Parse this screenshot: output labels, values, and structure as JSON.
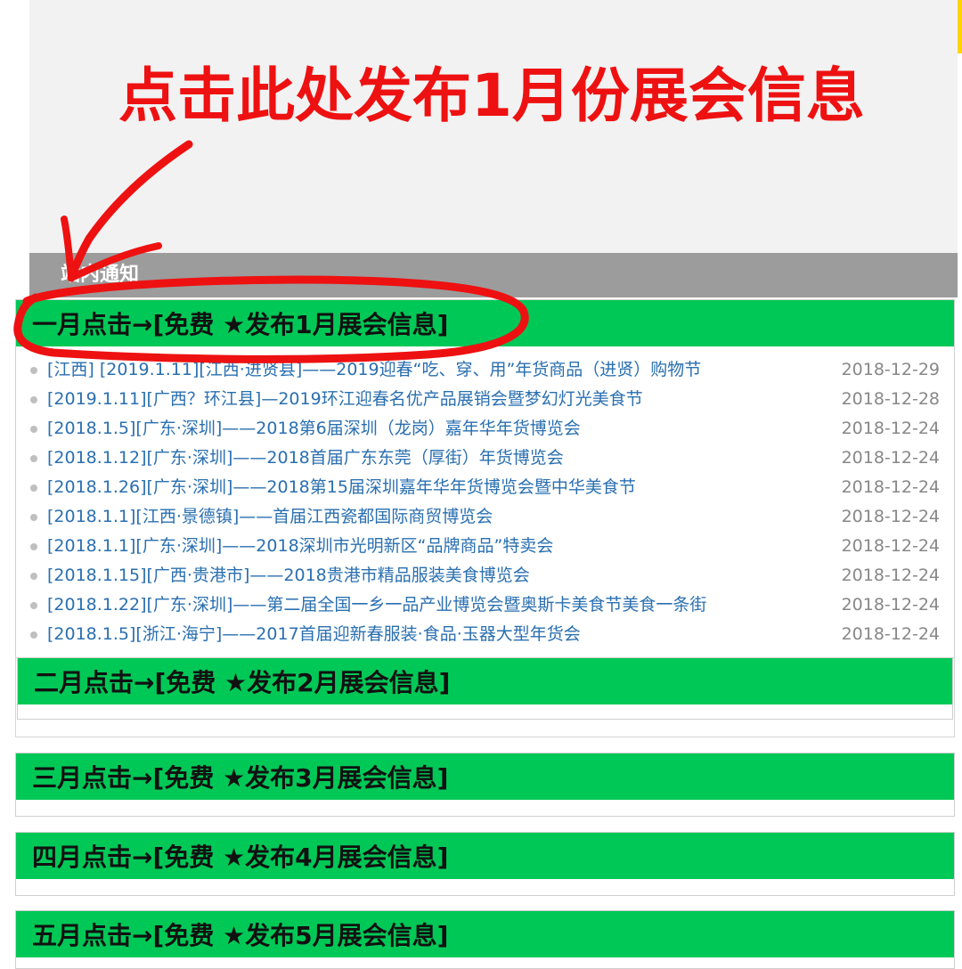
{
  "annotation": {
    "title": "点击此处发布1月份展会信息",
    "color": "#ee1111"
  },
  "notice": {
    "title": "站内通知"
  },
  "colors": {
    "header_green": "#00c857",
    "link_blue": "#2a6fb0",
    "date_gray": "#888888"
  },
  "months": [
    {
      "header": "一月点击→[免费 ★发布1月展会信息]",
      "items": [
        {
          "text": "[江西] [2019.1.11][江西·进贤县]——2019迎春“吃、穿、用”年货商品（进贤）购物节",
          "date": "2018-12-29"
        },
        {
          "text": "[2019.1.11][广西？环江县]—2019环江迎春名优产品展销会暨梦幻灯光美食节",
          "date": "2018-12-28"
        },
        {
          "text": "[2018.1.5][广东·深圳]——2018第6届深圳（龙岗）嘉年华年货博览会",
          "date": "2018-12-24"
        },
        {
          "text": "[2018.1.12][广东·深圳]——2018首届广东东莞（厚街）年货博览会",
          "date": "2018-12-24"
        },
        {
          "text": "[2018.1.26][广东·深圳]——2018第15届深圳嘉年华年货博览会暨中华美食节",
          "date": "2018-12-24"
        },
        {
          "text": "[2018.1.1][江西·景德镇]——首届江西瓷都国际商贸博览会",
          "date": "2018-12-24"
        },
        {
          "text": "[2018.1.1][广东·深圳]——2018深圳市光明新区“品牌商品”特卖会",
          "date": "2018-12-24"
        },
        {
          "text": "[2018.1.15][广西·贵港市]——2018贵港市精品服装美食博览会",
          "date": "2018-12-24"
        },
        {
          "text": "[2018.1.22][广东·深圳]——第二届全国一乡一品产业博览会暨奥斯卡美食节美食一条街",
          "date": "2018-12-24"
        },
        {
          "text": "[2018.1.5][浙江·海宁]——2017首届迎新春服装·食品·玉器大型年货会",
          "date": "2018-12-24"
        }
      ]
    },
    {
      "header": "二月点击→[免费 ★发布2月展会信息]"
    },
    {
      "header": "三月点击→[免费 ★发布3月展会信息]"
    },
    {
      "header": "四月点击→[免费 ★发布4月展会信息]"
    },
    {
      "header": "五月点击→[免费 ★发布5月展会信息]"
    }
  ]
}
